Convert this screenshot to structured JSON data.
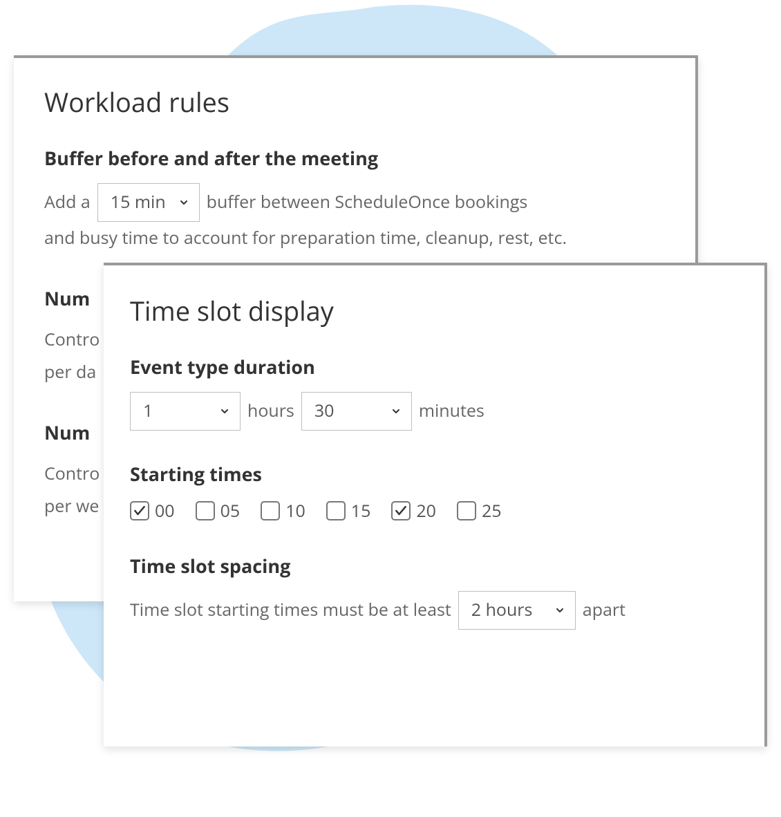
{
  "workload": {
    "title": "Workload rules",
    "buffer": {
      "heading": "Buffer before and after the meeting",
      "prefix": "Add a",
      "value": "15 min",
      "mid": "buffer between ScheduleOnce bookings",
      "tail": "and busy time to account for preparation time, cleanup, rest, etc."
    },
    "perday": {
      "heading_partial": "Num",
      "line1_partial": "Contro",
      "line2_partial": "per da"
    },
    "perweek": {
      "heading_partial": "Num",
      "line1_partial": "Contro",
      "line2_partial": "per we"
    }
  },
  "timeslot": {
    "title": "Time slot display",
    "duration": {
      "heading": "Event type duration",
      "hours_value": "1",
      "hours_label": "hours",
      "minutes_value": "30",
      "minutes_label": "minutes"
    },
    "starting": {
      "heading": "Starting times",
      "options": [
        {
          "label": "00",
          "checked": true
        },
        {
          "label": "05",
          "checked": false
        },
        {
          "label": "10",
          "checked": false
        },
        {
          "label": "15",
          "checked": false
        },
        {
          "label": "20",
          "checked": true
        },
        {
          "label": "25",
          "checked": false
        }
      ]
    },
    "spacing": {
      "heading": "Time slot spacing",
      "prefix": "Time slot starting times must be at least",
      "value": "2 hours",
      "suffix": "apart"
    }
  }
}
